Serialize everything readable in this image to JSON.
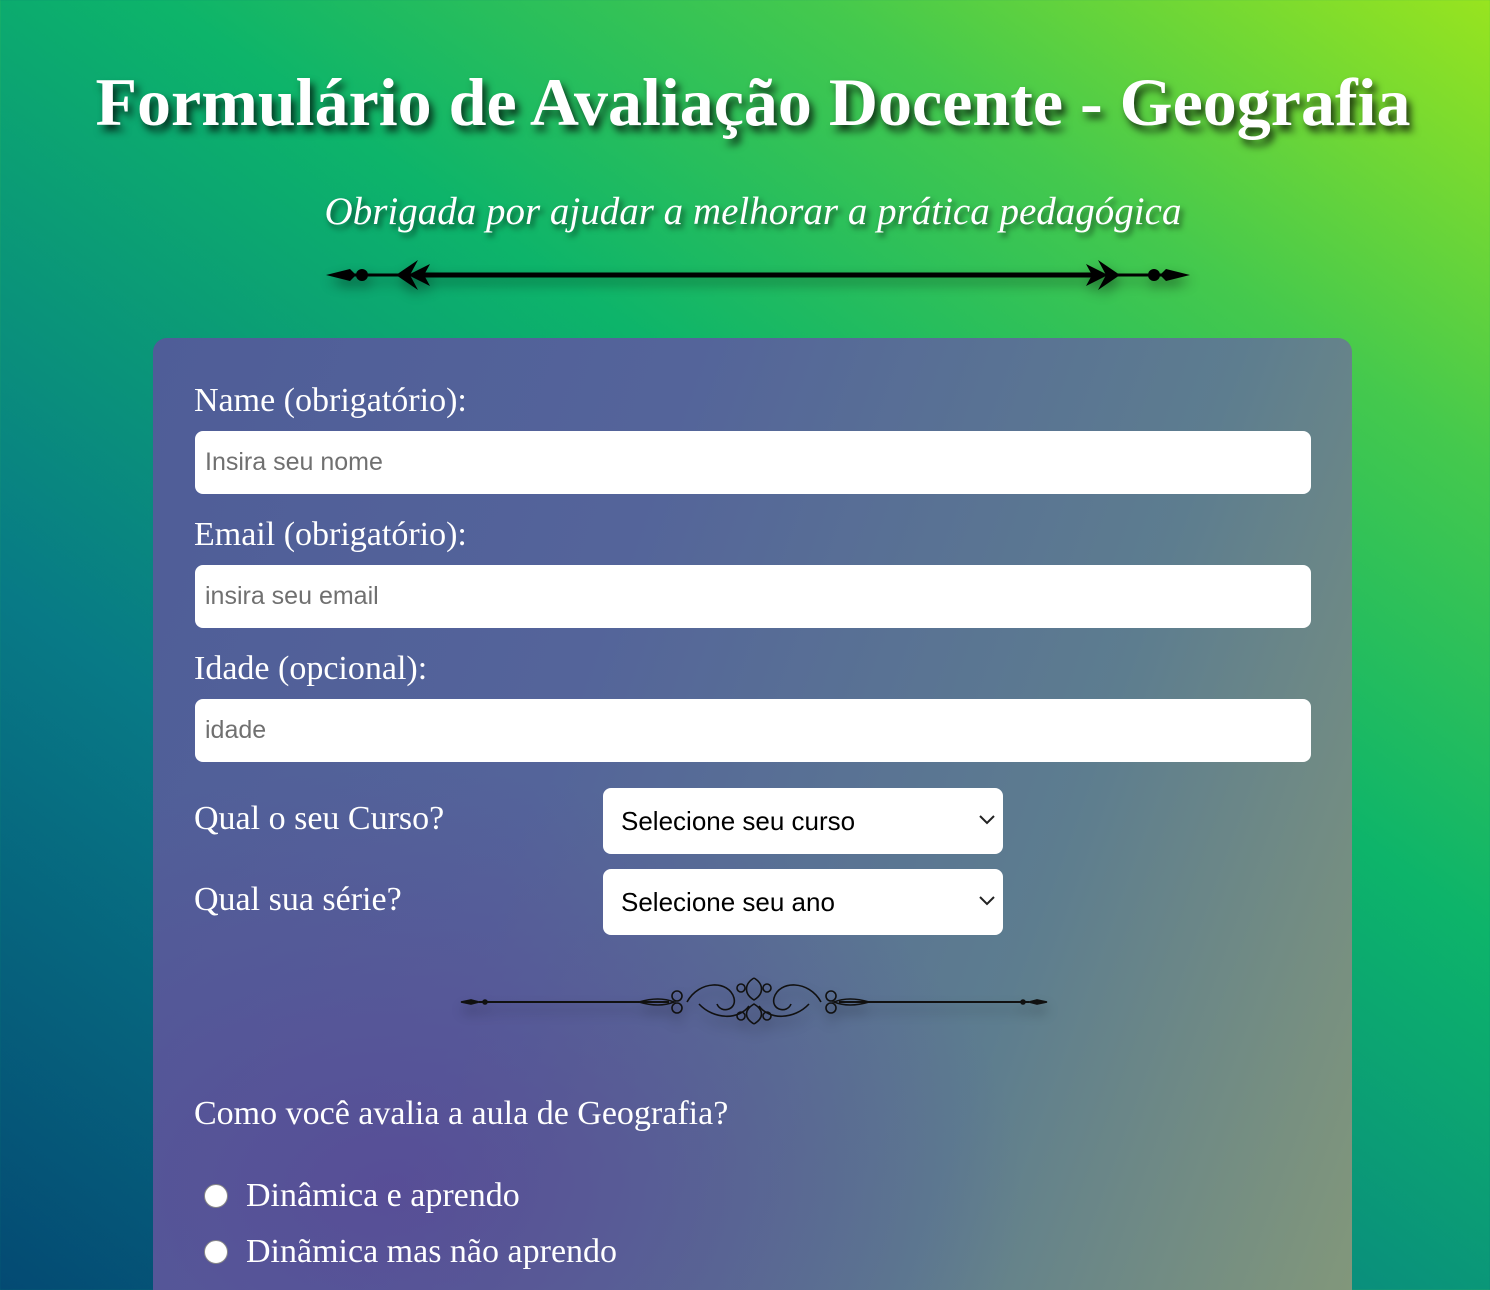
{
  "header": {
    "title": "Formulário de Avaliação Docente - Geografia",
    "subtitle": "Obrigada por ajudar a melhorar a prática pedagógica"
  },
  "form": {
    "name": {
      "label": "Name (obrigatório):",
      "placeholder": "Insira seu nome",
      "value": ""
    },
    "email": {
      "label": "Email (obrigatório):",
      "placeholder": "insira seu email",
      "value": ""
    },
    "age": {
      "label": "Idade (opcional):",
      "placeholder": "idade",
      "value": ""
    },
    "course": {
      "label": "Qual o seu Curso?",
      "selected": "Selecione seu curso"
    },
    "grade": {
      "label": "Qual sua série?",
      "selected": "Selecione seu ano"
    },
    "rating": {
      "question": "Como você avalia a aula de Geografia?",
      "options": [
        {
          "label": "Dinâmica e aprendo",
          "checked": false
        },
        {
          "label": "Dinãmica mas não aprendo",
          "checked": false
        }
      ]
    }
  },
  "icons": {
    "top_divider": "ornamental-arrow-divider-icon",
    "mid_divider": "ornamental-scroll-divider-icon",
    "select_arrow": "chevron-down-icon"
  },
  "colors": {
    "text": "#ffffff",
    "card_start": "#4f5d98",
    "card_end": "#83987a",
    "bg_start": "#044a73",
    "bg_end": "#98e41f"
  }
}
